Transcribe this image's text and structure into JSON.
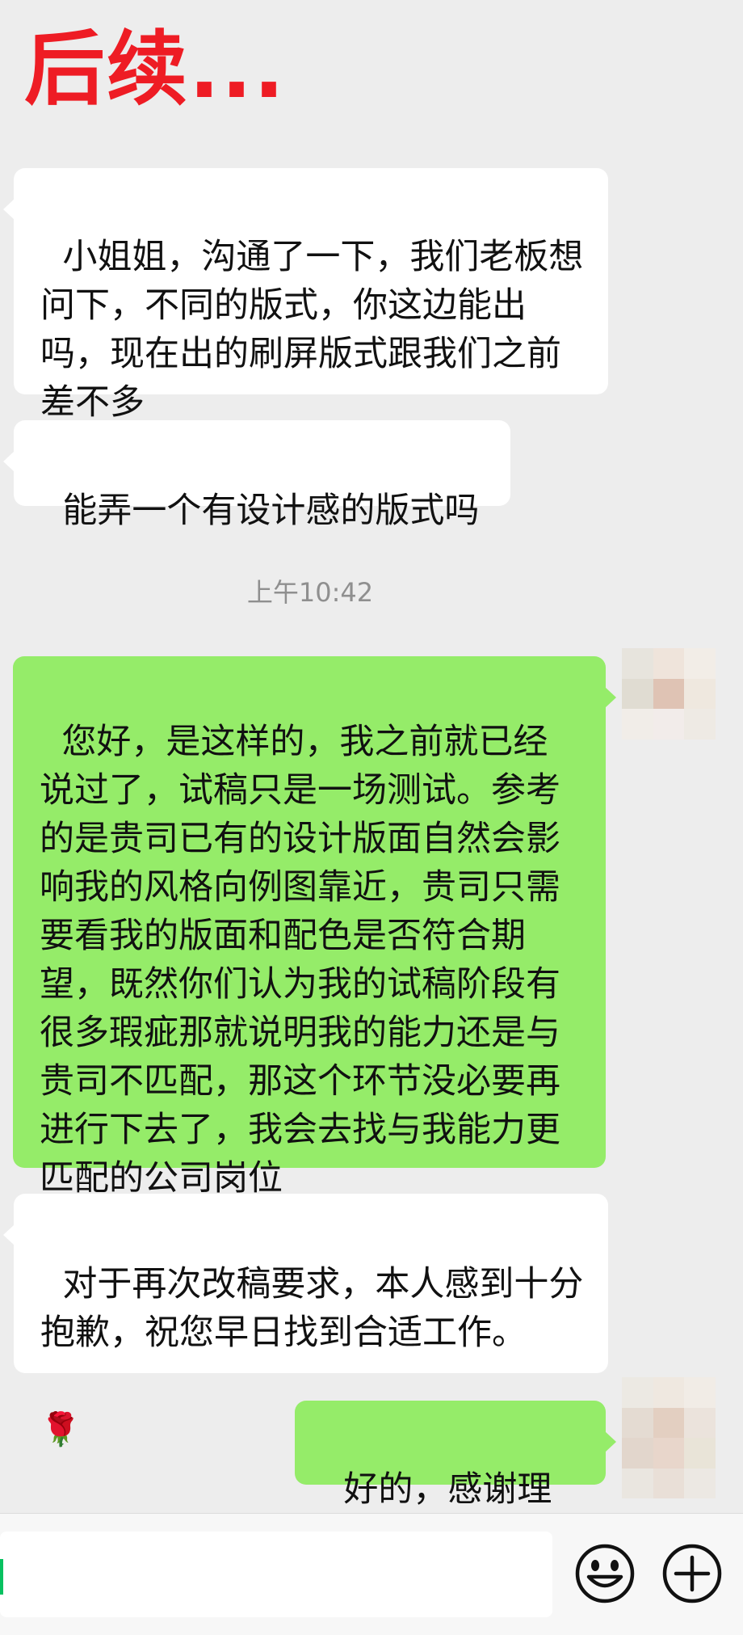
{
  "header": {
    "title": "后续..."
  },
  "messages": [
    {
      "side": "left",
      "text": "小姐姐，沟通了一下，我们老板想问下，不同的版式，你这边能出吗，现在出的刷屏版式跟我们之前差不多"
    },
    {
      "side": "left",
      "text": "能弄一个有设计感的版式吗"
    },
    {
      "type": "time",
      "text": "上午10:42"
    },
    {
      "side": "right",
      "text": "您好，是这样的，我之前就已经说过了，试稿只是一场测试。参考的是贵司已有的设计版面自然会影响我的风格向例图靠近，贵司只需要看我的版面和配色是否符合期望，既然你们认为我的试稿阶段有很多瑕疵那就说明我的能力还是与贵司不匹配，那这个环节没必要再进行下去了，我会去找与我能力更匹配的公司岗位"
    },
    {
      "side": "left",
      "text": "对于再次改稿要求，本人感到十分抱歉，祝您早日找到合适工作。",
      "emoji": "🌹"
    },
    {
      "side": "right",
      "text": "好的，感谢理解"
    }
  ],
  "input": {
    "value": "",
    "emoji_icon": "smiley-face-icon",
    "more_icon": "plus-circle-icon"
  },
  "colors": {
    "background": "#ededed",
    "incoming_bubble": "#ffffff",
    "outgoing_bubble": "#95ec69",
    "title": "#ee1c24",
    "timestamp": "#8f8f8f"
  }
}
